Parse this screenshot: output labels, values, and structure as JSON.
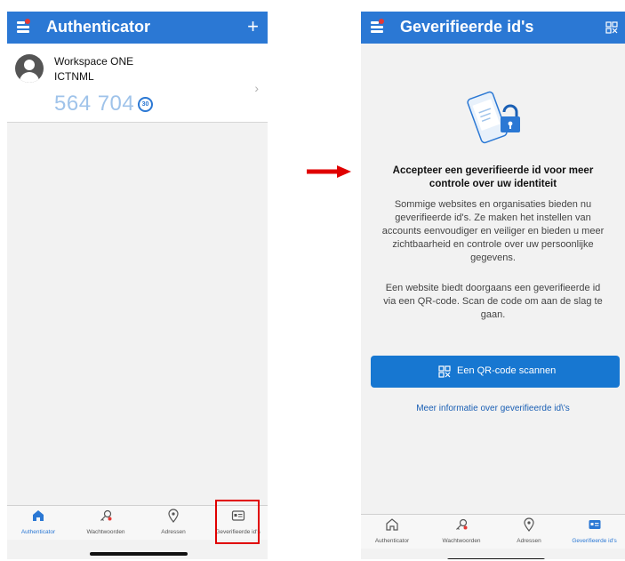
{
  "left_screen": {
    "header": {
      "title": "Authenticator",
      "add_label": "+"
    },
    "account": {
      "name": "Workspace ONE",
      "username": "ICTNML",
      "code": "564 704",
      "timer": "30",
      "chevron": "›"
    },
    "tabs": [
      {
        "label": "Authenticator",
        "icon": "home-icon",
        "active": true
      },
      {
        "label": "Wachtwoorden",
        "icon": "key-icon",
        "active": false
      },
      {
        "label": "Adressen",
        "icon": "location-pin-icon",
        "active": false
      },
      {
        "label": "Geverifieerde id's",
        "icon": "id-card-icon",
        "active": false
      }
    ]
  },
  "right_screen": {
    "header": {
      "title": "Geverifieerde id's"
    },
    "heading": "Accepteer een geverifieerde id voor meer controle over uw identiteit",
    "paragraph1": "Sommige websites en organisaties bieden nu geverifieerde id's. Ze maken het instellen van accounts eenvoudiger en veiliger en bieden u meer zichtbaarheid en controle over uw persoonlijke gegevens.",
    "paragraph2": "Een website biedt doorgaans een geverifieerde id via een QR-code. Scan de code om aan de slag te gaan.",
    "scan_button": "Een QR-code scannen",
    "more_link": "Meer informatie over geverifieerde id\\'s",
    "tabs": [
      {
        "label": "Authenticator",
        "icon": "home-icon",
        "active": false
      },
      {
        "label": "Wachtwoorden",
        "icon": "key-icon",
        "active": false
      },
      {
        "label": "Adressen",
        "icon": "location-pin-icon",
        "active": false
      },
      {
        "label": "Geverifieerde id's",
        "icon": "id-card-icon",
        "active": true
      }
    ]
  },
  "colors": {
    "brand_blue": "#2b78d4",
    "button_blue": "#1777d1",
    "highlight_red": "#e00000",
    "otp_text": "#9fc3ea"
  }
}
